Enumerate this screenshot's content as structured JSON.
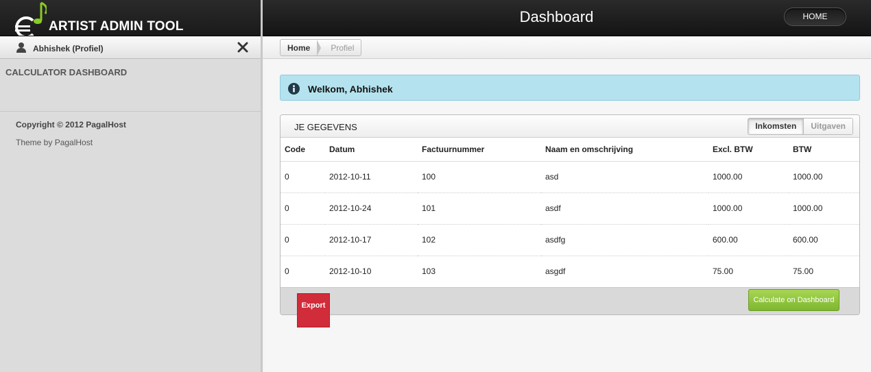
{
  "brand": {
    "logo_text": "ARTIST ADMIN TOOL",
    "accent": "#8ac926"
  },
  "header": {
    "title": "Dashboard",
    "home_button": "HOME"
  },
  "user": {
    "name": "Abhishek (Profiel)"
  },
  "sidebar": {
    "section_title": "CALCULATOR DASHBOARD",
    "copyright": "Copyright © 2012 PagalHost",
    "theme_credit": "Theme by PagalHost"
  },
  "breadcrumb": {
    "home": "Home",
    "current": "Profiel"
  },
  "alert": {
    "text": "Welkom, Abhishek",
    "color": "#b4e3ef"
  },
  "panel": {
    "title": "JE GEGEVENS",
    "tabs": {
      "active": "Inkomsten",
      "inactive": "Uitgaven"
    },
    "columns": [
      "Code",
      "Datum",
      "Factuurnummer",
      "Naam en omschrijving",
      "Excl. BTW",
      "BTW"
    ],
    "rows": [
      [
        "0",
        "2012-10-11",
        "100",
        "asd",
        "1000.00",
        "1000.00"
      ],
      [
        "0",
        "2012-10-24",
        "101",
        "asdf",
        "1000.00",
        "1000.00"
      ],
      [
        "0",
        "2012-10-17",
        "102",
        "asdfg",
        "600.00",
        "600.00"
      ],
      [
        "0",
        "2012-10-10",
        "103",
        "asgdf",
        "75.00",
        "75.00"
      ]
    ]
  },
  "actions": {
    "export": "Export",
    "export_color": "#d12c3a",
    "calculate": "Calculate on Dashboard",
    "calculate_color": "#8cc63f"
  }
}
